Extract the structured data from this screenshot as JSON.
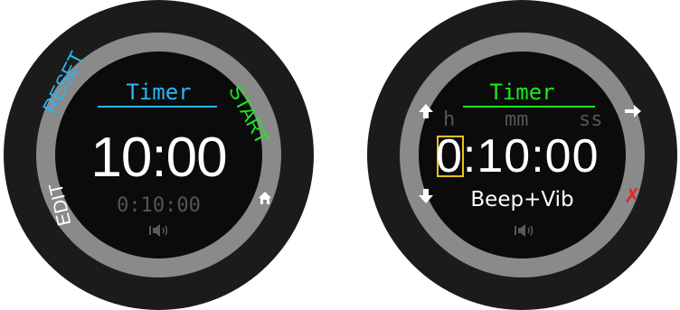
{
  "left_watch": {
    "title": "Timer",
    "main_time": "10:00",
    "set_time": "0:10:00",
    "sound_icon": "speaker-vibrate-icon",
    "buttons": {
      "top_left": "RESET",
      "top_right": "START",
      "bottom_left": "EDIT",
      "bottom_right_icon": "home-icon"
    },
    "colors": {
      "title": "#29b6f6",
      "reset": "#29b6f6",
      "start": "#1ee81e",
      "edit": "#ffffff"
    }
  },
  "right_watch": {
    "title": "Timer",
    "units": {
      "hours": "h",
      "minutes": "mm",
      "seconds": "ss"
    },
    "time_hours": "0",
    "time_rest": ":10:00",
    "alert_mode": "Beep+Vib",
    "sound_icon": "speaker-vibrate-icon",
    "buttons": {
      "top_left_icon": "arrow-up-icon",
      "bottom_left_icon": "arrow-down-icon",
      "top_right_icon": "arrow-right-icon",
      "bottom_right": "✗"
    },
    "colors": {
      "title": "#1ee81e",
      "selection": "#e8c21a",
      "cancel": "#ee2222"
    }
  }
}
